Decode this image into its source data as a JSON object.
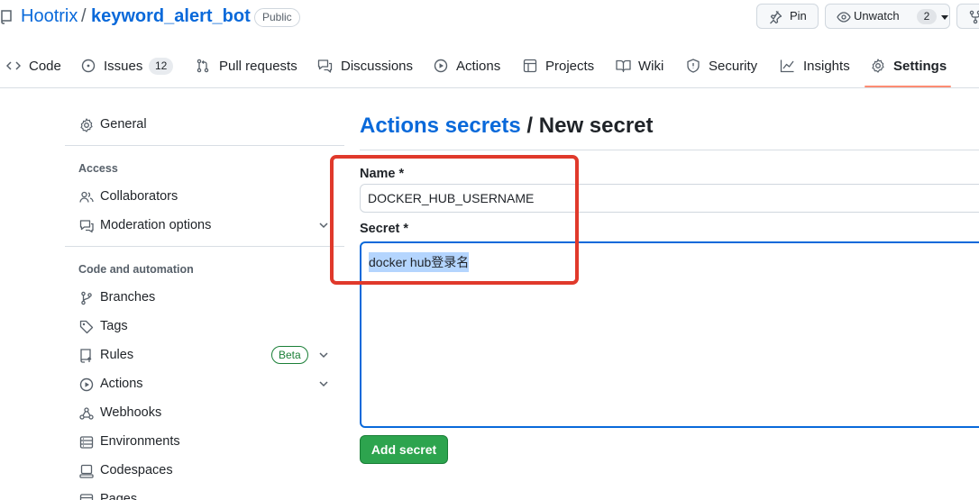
{
  "repo": {
    "owner": "Hootrix",
    "separator": "/",
    "name": "keyword_alert_bot",
    "visibility": "Public",
    "pin_label": "Pin",
    "watch_label": "Unwatch",
    "watch_count": "2"
  },
  "tabs": [
    {
      "label": "Code",
      "icon": "code-icon"
    },
    {
      "label": "Issues",
      "count": "12",
      "icon": "issue-icon"
    },
    {
      "label": "Pull requests",
      "icon": "pull-request-icon"
    },
    {
      "label": "Discussions",
      "icon": "discussion-icon"
    },
    {
      "label": "Actions",
      "icon": "play-icon"
    },
    {
      "label": "Projects",
      "icon": "table-icon"
    },
    {
      "label": "Wiki",
      "icon": "book-icon"
    },
    {
      "label": "Security",
      "icon": "shield-icon"
    },
    {
      "label": "Insights",
      "icon": "graph-icon"
    },
    {
      "label": "Settings",
      "icon": "gear-icon",
      "selected": true
    }
  ],
  "sidebar": {
    "general": "General",
    "access_heading": "Access",
    "collaborators": "Collaborators",
    "moderation": "Moderation options",
    "code_heading": "Code and automation",
    "branches": "Branches",
    "tags": "Tags",
    "rules": "Rules",
    "rules_badge": "Beta",
    "actions": "Actions",
    "webhooks": "Webhooks",
    "environments": "Environments",
    "codespaces": "Codespaces",
    "pages": "Pages"
  },
  "main": {
    "breadcrumb_link": "Actions secrets",
    "breadcrumb_sep": "/",
    "title": "New secret",
    "name_label": "Name *",
    "name_value": "DOCKER_HUB_USERNAME",
    "secret_label": "Secret *",
    "secret_value": "docker hub登录名",
    "submit_label": "Add secret"
  },
  "colors": {
    "link": "#0969da",
    "primary_button": "#2da44e",
    "selected_tab_underline": "#fd8c73",
    "annotation": "#e0392b",
    "text_selection": "#b4d5fe"
  }
}
